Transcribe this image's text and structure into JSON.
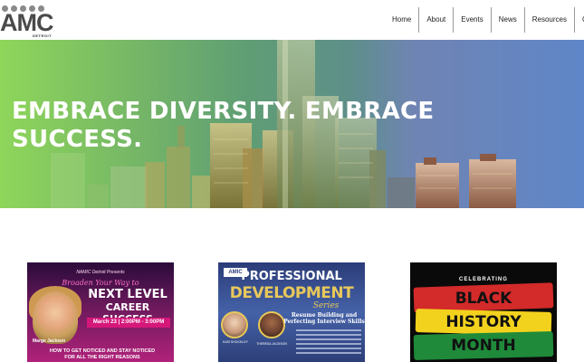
{
  "logo": {
    "mark": "AMC",
    "sub": "DETROIT"
  },
  "nav": {
    "items": [
      "Home",
      "About",
      "Events",
      "News",
      "Resources",
      "Co"
    ]
  },
  "hero": {
    "title_line1": "EMBRACE DIVERSITY. EMBRACE",
    "title_line2": "SUCCESS."
  },
  "cards": [
    {
      "small": "NAMIC Detroit Presents",
      "script": "Broaden Your Way to",
      "big1": "NEXT LEVEL",
      "big2": "CAREER SUCCESS",
      "date": "March 23 | 2:00PM - 3:00PM",
      "name": "Marge Jackson",
      "line1": "HOW TO GET NOTICED AND STAY NOTICED",
      "line2": "FOR ALL THE RIGHT REASONS"
    },
    {
      "logo": "AMIC",
      "t1": "PROFESSIONAL",
      "t2": "DEVELOPMENT",
      "t3": "Series",
      "s1": "Resume Building and",
      "s2": "Perfecting Interview Skills",
      "n1": "KASI SHOCKLEY",
      "n2": "THERESA JACKSON"
    },
    {
      "celebrating": "CELEBRATING",
      "w1": "BLACK",
      "w2": "HISTORY",
      "w3": "MONTH"
    }
  ],
  "colors": {
    "hero_left": "#8ed65a",
    "hero_right": "#5f86c8",
    "card3_red": "#d32a2a",
    "card3_yellow": "#f3d21d",
    "card3_green": "#1f8a3a"
  }
}
